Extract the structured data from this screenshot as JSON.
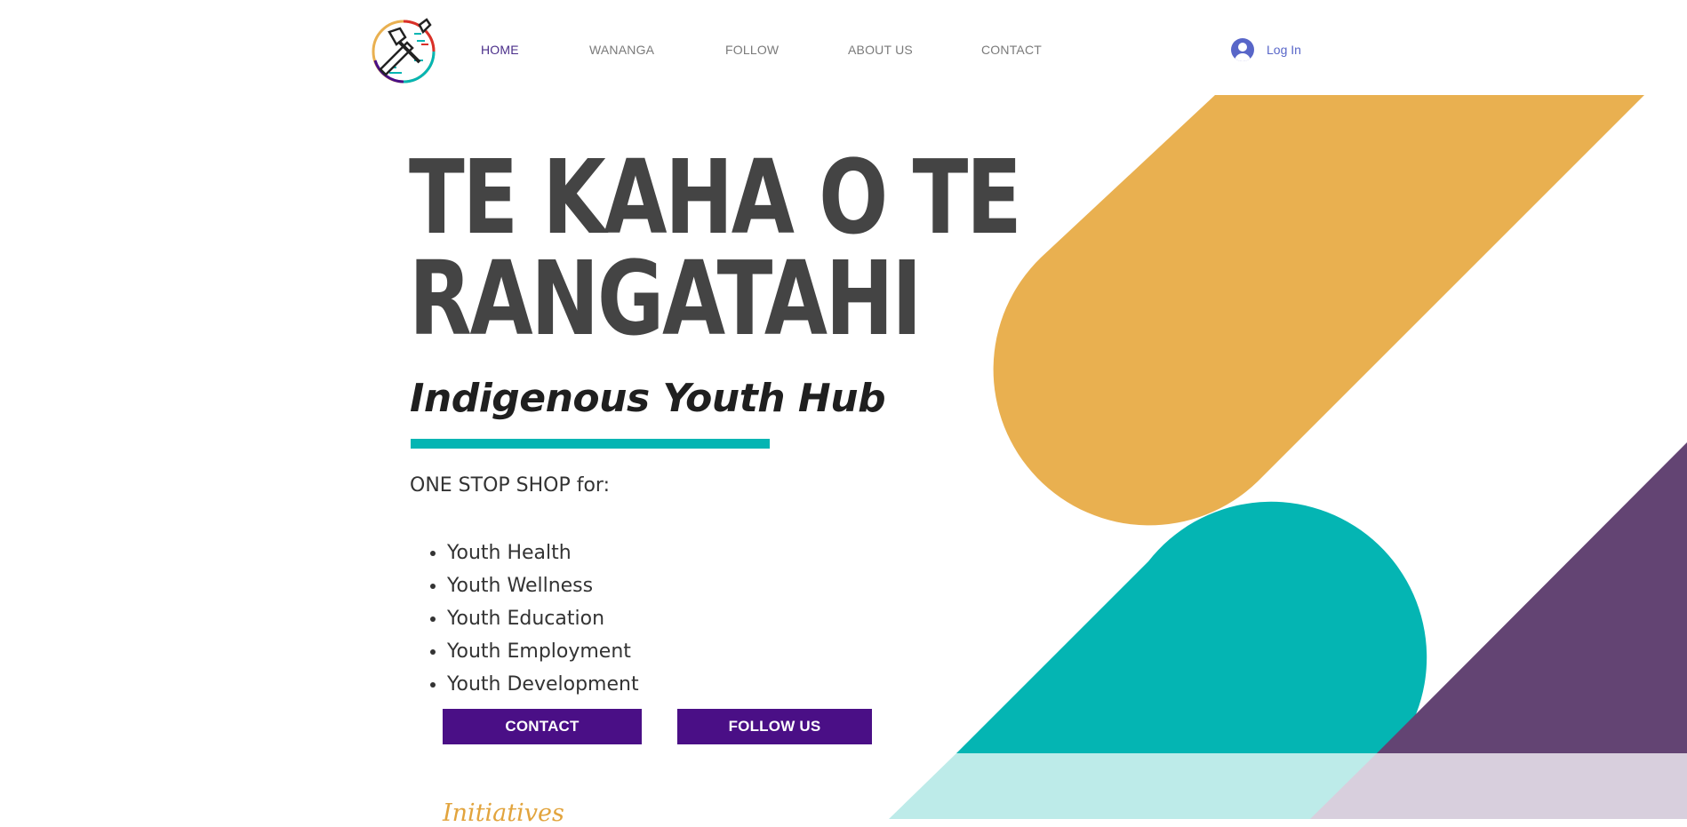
{
  "nav": {
    "items": [
      {
        "label": "HOME",
        "active": true
      },
      {
        "label": "WANANGA",
        "active": false
      },
      {
        "label": "FOLLOW",
        "active": false
      },
      {
        "label": "ABOUT US",
        "active": false
      },
      {
        "label": "CONTACT",
        "active": false
      }
    ],
    "login_label": "Log In"
  },
  "hero": {
    "title_line1": "TE KAHA O TE",
    "title_line2": "RANGATAHI",
    "subtitle": "Indigenous Youth Hub",
    "intro": "ONE STOP SHOP for:",
    "services": [
      "Youth Health",
      "Youth Wellness",
      "Youth Education",
      "Youth Employment",
      "Youth Development"
    ],
    "contact_button": "CONTACT",
    "follow_button": "FOLLOW US"
  },
  "next_section_heading": "Initiatives",
  "colors": {
    "accent_purple": "#4a0f86",
    "teal": "#04b5b3",
    "gold": "#e9b050",
    "plum": "#634473",
    "light_teal": "#bdebe9",
    "light_plum": "#d8cfdd",
    "login_blue": "#5866c8",
    "title_gray": "#444444"
  },
  "icons": {
    "logo": "carving-tools-circle-logo",
    "login": "user-avatar-icon"
  }
}
